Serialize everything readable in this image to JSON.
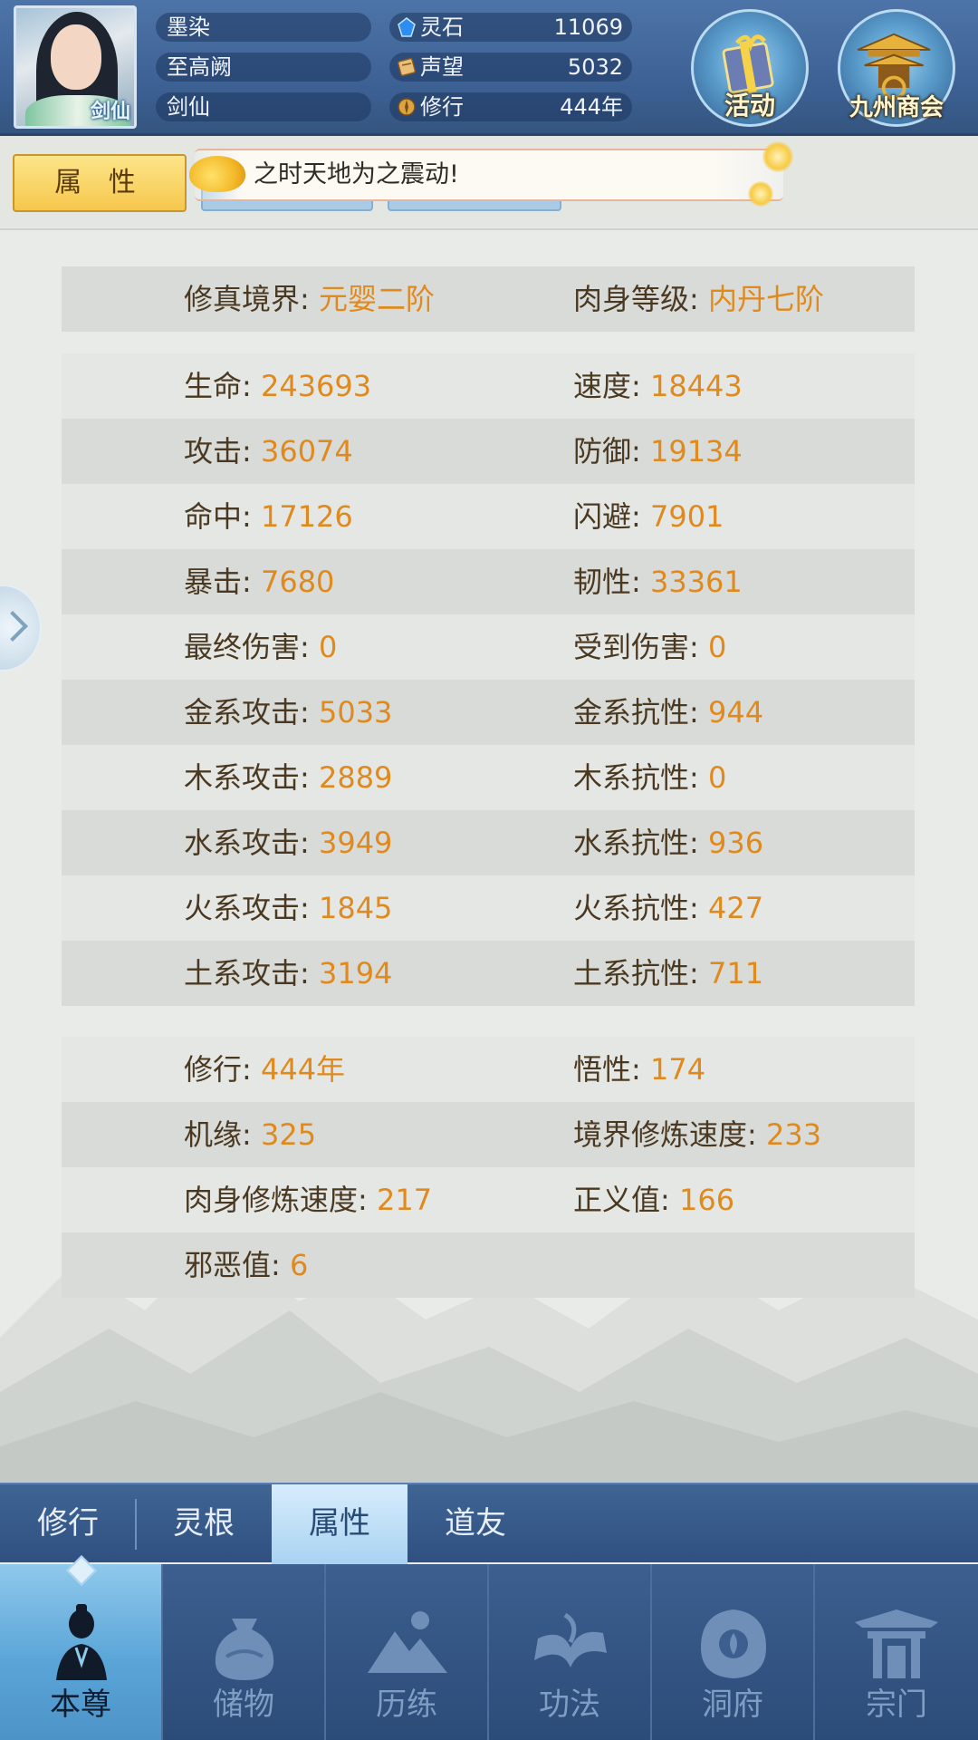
{
  "header": {
    "avatar_badge": "剑仙",
    "name": "墨染",
    "title": "至高阙",
    "class": "剑仙",
    "resources": [
      {
        "icon": "spirit-stone-icon",
        "label": "灵石",
        "value": "11069"
      },
      {
        "icon": "reputation-icon",
        "label": "声望",
        "value": "5032"
      },
      {
        "icon": "cultivation-icon",
        "label": "修行",
        "value": "444年"
      }
    ],
    "buttons": {
      "events": "活动",
      "shop": "九州商会"
    }
  },
  "attr_tab": "属 性",
  "marquee": "之时天地为之震动!",
  "realm": {
    "left_label": "修真境界: ",
    "left_value": "元婴二阶",
    "right_label": "肉身等级: ",
    "right_value": "内丹七阶"
  },
  "stats": [
    {
      "l_label": "生命: ",
      "l_value": "243693",
      "r_label": "速度: ",
      "r_value": "18443"
    },
    {
      "l_label": "攻击: ",
      "l_value": "36074",
      "r_label": "防御: ",
      "r_value": "19134"
    },
    {
      "l_label": "命中: ",
      "l_value": "17126",
      "r_label": "闪避: ",
      "r_value": "7901"
    },
    {
      "l_label": "暴击: ",
      "l_value": "7680",
      "r_label": "韧性: ",
      "r_value": "33361"
    },
    {
      "l_label": "最终伤害: ",
      "l_value": "0",
      "r_label": "受到伤害: ",
      "r_value": "0"
    },
    {
      "l_label": "金系攻击: ",
      "l_value": "5033",
      "r_label": "金系抗性: ",
      "r_value": "944"
    },
    {
      "l_label": "木系攻击: ",
      "l_value": "2889",
      "r_label": "木系抗性: ",
      "r_value": "0"
    },
    {
      "l_label": "水系攻击: ",
      "l_value": "3949",
      "r_label": "水系抗性: ",
      "r_value": "936"
    },
    {
      "l_label": "火系攻击: ",
      "l_value": "1845",
      "r_label": "火系抗性: ",
      "r_value": "427"
    },
    {
      "l_label": "土系攻击: ",
      "l_value": "3194",
      "r_label": "土系抗性: ",
      "r_value": "711"
    }
  ],
  "extra": [
    {
      "l_label": "修行: ",
      "l_value": "444年",
      "r_label": "悟性: ",
      "r_value": "174"
    },
    {
      "l_label": "机缘: ",
      "l_value": "325",
      "r_label": "境界修炼速度: ",
      "r_value": "233"
    },
    {
      "l_label": "肉身修炼速度: ",
      "l_value": "217",
      "r_label": "正义值: ",
      "r_value": "166"
    },
    {
      "l_label": "邪恶值: ",
      "l_value": "6"
    }
  ],
  "subnav": [
    "修行",
    "灵根",
    "属性",
    "道友"
  ],
  "subnav_active": 2,
  "mainnav": [
    {
      "label": "本尊",
      "icon": "character-icon"
    },
    {
      "label": "储物",
      "icon": "storage-bag-icon"
    },
    {
      "label": "历练",
      "icon": "mountain-icon"
    },
    {
      "label": "功法",
      "icon": "book-icon"
    },
    {
      "label": "洞府",
      "icon": "cave-icon"
    },
    {
      "label": "宗门",
      "icon": "sect-gate-icon"
    }
  ],
  "colors": {
    "accent": "#e08a1e",
    "nav": "#2c4c78",
    "active_tab": "#f6c74c"
  }
}
